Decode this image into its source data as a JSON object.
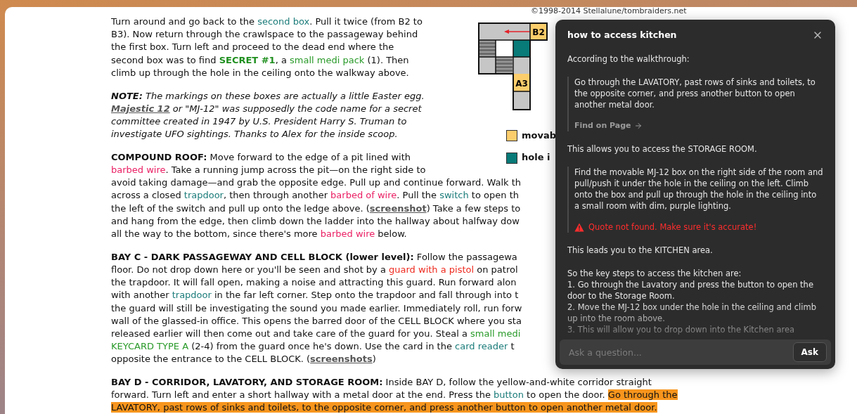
{
  "copyright": "©1998-2014 Stellalune/tombraiders.net",
  "map": {
    "labels": [
      "B2",
      "A3"
    ]
  },
  "legend": [
    {
      "label": "movab",
      "color": "#fccd6b"
    },
    {
      "label": "hole i",
      "color": "#087a78"
    }
  ],
  "article": [
    {
      "kind": "body",
      "lines": [
        [
          {
            "kind": "plain",
            "text": "Turn around and go back to the "
          },
          {
            "kind": "object",
            "text": "second box"
          },
          {
            "kind": "plain",
            "text": ". Pull it twice (from B2 to"
          }
        ],
        [
          {
            "kind": "plain",
            "text": "B3). Now return through the crawlspace to the passageway behind"
          }
        ],
        [
          {
            "kind": "plain",
            "text": "the first box. Turn left and proceed to the dead end where the"
          }
        ],
        [
          {
            "kind": "plain",
            "text": "second box was to find "
          },
          {
            "kind": "secret",
            "text": "SECRET #1"
          },
          {
            "kind": "plain",
            "text": ", a "
          },
          {
            "kind": "item",
            "text": "small medi pack"
          },
          {
            "kind": "plain",
            "text": " (1). Then"
          }
        ],
        [
          {
            "kind": "plain",
            "text": "climb up through the hole in the ceiling onto the walkway above."
          }
        ]
      ]
    },
    {
      "kind": "note",
      "lines": [
        [
          {
            "kind": "bold",
            "text": "NOTE:"
          },
          {
            "kind": "plain",
            "text": " The markings on these boxes are actually a little Easter egg."
          }
        ],
        [
          {
            "kind": "link",
            "text": "Majestic 12"
          },
          {
            "kind": "plain",
            "text": " or \"MJ-12\" was supposedly the code name for a secret"
          }
        ],
        [
          {
            "kind": "plain",
            "text": "committee created in 1947 by U.S. President Harry S. Truman to"
          }
        ],
        [
          {
            "kind": "plain",
            "text": "investigate UFO sightings. Thanks to Alex for the inside scoop."
          }
        ]
      ]
    },
    {
      "kind": "body",
      "lines": [
        [
          {
            "kind": "bold",
            "text": "COMPOUND ROOF:"
          },
          {
            "kind": "plain",
            "text": " Move forward to the edge of a pit lined with"
          }
        ],
        [
          {
            "kind": "hazard",
            "text": "barbed wire"
          },
          {
            "kind": "plain",
            "text": ". Take a running jump across the pit—on the right side to"
          }
        ],
        [
          {
            "kind": "plain",
            "text": "avoid taking damage—and grab the opposite edge. Pull up and continue forward. Walk th"
          }
        ],
        [
          {
            "kind": "plain",
            "text": "across a closed "
          },
          {
            "kind": "object",
            "text": "trapdoor"
          },
          {
            "kind": "plain",
            "text": ", then through another "
          },
          {
            "kind": "hazard",
            "text": "barbed of wire"
          },
          {
            "kind": "plain",
            "text": ". Pull the "
          },
          {
            "kind": "object",
            "text": "switch"
          },
          {
            "kind": "plain",
            "text": " to open th"
          }
        ],
        [
          {
            "kind": "plain",
            "text": "the left of the switch and pull up onto the ledge above. ("
          },
          {
            "kind": "link",
            "text": "screenshot"
          },
          {
            "kind": "plain",
            "text": ") Take a few steps to"
          }
        ],
        [
          {
            "kind": "plain",
            "text": "and hang from the edge, then climb down the ladder into the hallway about halfway dow"
          }
        ],
        [
          {
            "kind": "plain",
            "text": "all the way to the bottom, since there's more "
          },
          {
            "kind": "hazard",
            "text": "barbed wire"
          },
          {
            "kind": "plain",
            "text": " below."
          }
        ]
      ]
    },
    {
      "kind": "body",
      "lines": [
        [
          {
            "kind": "bold",
            "text": "BAY C - DARK PASSAGEWAY AND CELL BLOCK (lower level):"
          },
          {
            "kind": "plain",
            "text": " Follow the passagewa"
          }
        ],
        [
          {
            "kind": "plain",
            "text": "floor. Do not drop down here or you'll be seen and shot by a "
          },
          {
            "kind": "enemy",
            "text": "guard with a pistol"
          },
          {
            "kind": "plain",
            "text": " on patrol"
          }
        ],
        [
          {
            "kind": "plain",
            "text": "the trapdoor. It will fall open, making a noise and attracting this guard. Run forward alon"
          }
        ],
        [
          {
            "kind": "plain",
            "text": "with another "
          },
          {
            "kind": "object",
            "text": "trapdoor"
          },
          {
            "kind": "plain",
            "text": " in the far left corner. Step onto the trapdoor and fall through into t"
          }
        ],
        [
          {
            "kind": "plain",
            "text": "the guard will still be investigating the sound you made earlier. Immediately roll, run forw"
          }
        ],
        [
          {
            "kind": "plain",
            "text": "wall of the glassed-in office. This opens the barred door of the CELL BLOCK where you sta"
          }
        ],
        [
          {
            "kind": "plain",
            "text": "released earlier will then come out and take care of the guard for you. Steal a "
          },
          {
            "kind": "item",
            "text": "small medi"
          }
        ],
        [
          {
            "kind": "item",
            "text": "KEYCARD TYPE A"
          },
          {
            "kind": "plain",
            "text": " (2-4) from the guard once he's down. Use the card in the "
          },
          {
            "kind": "object",
            "text": "card reader"
          },
          {
            "kind": "plain",
            "text": " t"
          }
        ],
        [
          {
            "kind": "plain",
            "text": "opposite the entrance to the CELL BLOCK. ("
          },
          {
            "kind": "link",
            "text": "screenshots"
          },
          {
            "kind": "plain",
            "text": ")"
          }
        ]
      ]
    },
    {
      "kind": "body",
      "lines": [
        [
          {
            "kind": "bold",
            "text": "BAY D - CORRIDOR, LAVATORY, AND STORAGE ROOM:"
          },
          {
            "kind": "plain",
            "text": " Inside BAY D, follow the yellow-and-white corridor straight"
          }
        ],
        [
          {
            "kind": "plain",
            "text": "forward. Turn left and enter a short hallway with a metal door at the end. Press the "
          },
          {
            "kind": "object",
            "text": "button"
          },
          {
            "kind": "plain",
            "text": " to open the door. "
          },
          {
            "kind": "highlight",
            "text": "Go through the"
          }
        ],
        [
          {
            "kind": "highlight",
            "text": "LAVATORY, past rows of sinks and toilets, to the opposite corner, and press another button to open another metal door."
          }
        ]
      ]
    }
  ],
  "assistant": {
    "title": "how to access kitchen",
    "answer": [
      {
        "kind": "paragraph",
        "text": "According to the walkthrough:"
      },
      {
        "kind": "quote",
        "text": "Go through the LAVATORY, past rows of sinks and toilets, to the opposite corner, and press another button to open another metal door.",
        "found": true,
        "action": "Find on Page"
      },
      {
        "kind": "paragraph",
        "text": "This allows you to access the STORAGE ROOM."
      },
      {
        "kind": "quote",
        "text": "Find the movable MJ-12 box on the right side of the room and pull/push it under the hole in the ceiling on the left. Climb onto the box and pull up through the hole in the ceiling into a small room with dim, purple lighting.",
        "found": false,
        "warning": "Quote not found. Make sure it's accurate!"
      },
      {
        "kind": "paragraph",
        "text": "This leads you to the KITCHEN area."
      },
      {
        "kind": "list",
        "intro": "So the key steps to access the kitchen are:",
        "items": [
          "1. Go through the Lavatory and press the button to open the door to the Storage Room.",
          "2. Move the MJ-12 box under the hole in the ceiling and climb up into the room above.",
          "3. This will allow you to drop down into the Kitchen area"
        ]
      }
    ],
    "input": {
      "placeholder": "Ask a question..."
    },
    "submit": "Ask"
  }
}
